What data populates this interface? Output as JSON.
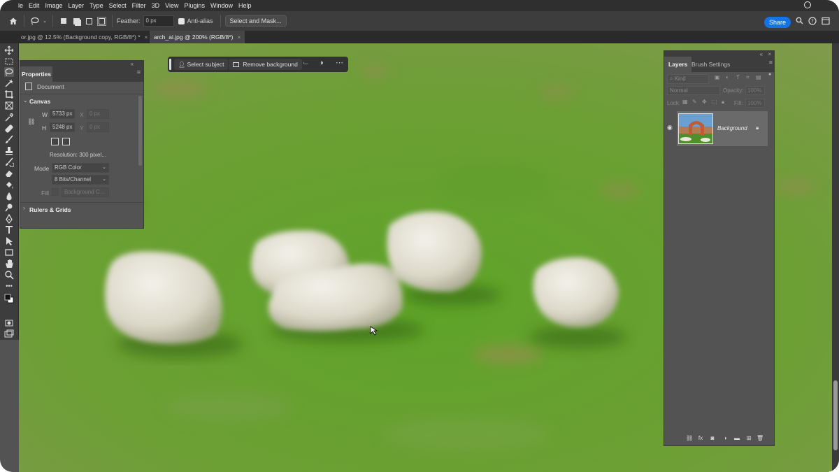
{
  "menu": [
    "le",
    "Edit",
    "Image",
    "Layer",
    "Type",
    "Select",
    "Filter",
    "3D",
    "View",
    "Plugins",
    "Window",
    "Help"
  ],
  "options": {
    "feather_label": "Feather:",
    "feather_value": "0 px",
    "antialias_label": "Anti-alias",
    "select_mask_label": "Select and Mask..."
  },
  "share_label": "Share",
  "tabs": [
    {
      "label": "or.jpg @ 12.5% (Background copy, RGB/8*) *",
      "close": "×"
    },
    {
      "label": "arch_ai.jpg @ 200% (RGB/8*)",
      "close": "×"
    }
  ],
  "properties": {
    "tab": "Properties",
    "doc_label": "Document",
    "canvas_label": "Canvas",
    "w_label": "W",
    "w_value": "5733 px",
    "h_label": "H",
    "h_value": "5248 px",
    "x_label": "X",
    "x_value": "0 px",
    "y_label": "Y",
    "y_value": "0 px",
    "resolution": "Resolution: 300 pixel...",
    "mode_label": "Mode",
    "mode_value": "RGB Color",
    "bits_value": "8 Bits/Channel",
    "fill_label": "Fill",
    "fill_value": "Background C...",
    "rulers_label": "Rulers & Grids"
  },
  "taskbar": {
    "select_subject": "Select subject",
    "remove_background": "Remove background"
  },
  "layers": {
    "tab_layers": "Layers",
    "tab_brush": "Brush Settings",
    "kind_placeholder": "Kind",
    "blend_mode": "Normal",
    "opacity_label": "Opacity:",
    "opacity_value": "100%",
    "lock_label": "Lock:",
    "fill_label": "Fill:",
    "fill_value": "100%",
    "layer_name": "Background"
  },
  "colors": {
    "accent": "#1473e6",
    "grass": "#5d9b2a",
    "panel": "#535353"
  }
}
